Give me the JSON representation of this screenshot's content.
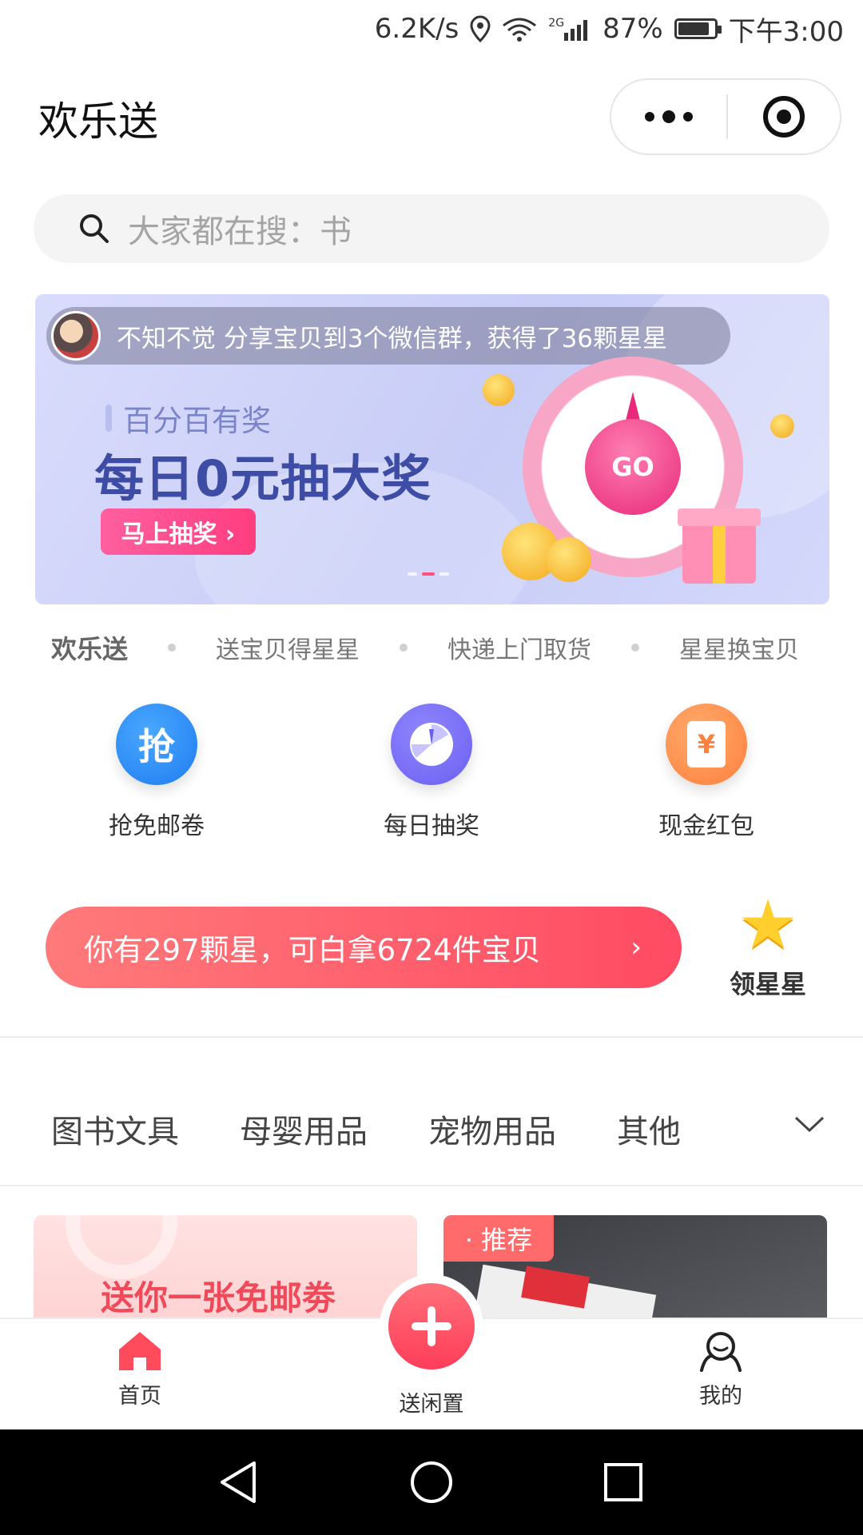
{
  "status_bar": {
    "speed": "6.2K/s",
    "network": "2G",
    "battery_percent": "87%",
    "battery_level": 0.87,
    "time": "下午3:00"
  },
  "header": {
    "title": "欢乐送"
  },
  "search": {
    "placeholder": "大家都在搜：书"
  },
  "banner": {
    "notice": "不知不觉 分享宝贝到3个微信群，获得了36颗星星",
    "subtitle": "百分百有奖",
    "title": "每日0元抽大奖",
    "button": "马上抽奖 ›",
    "wheel_label": "GO"
  },
  "features": {
    "brand": "欢乐送",
    "items": [
      "送宝贝得星星",
      "快递上门取货",
      "星星换宝贝"
    ]
  },
  "shortcuts": [
    {
      "label": "抢免邮卷",
      "glyph": "抢",
      "icon": "grab-icon"
    },
    {
      "label": "每日抽奖",
      "glyph": "",
      "icon": "lottery-wheel-icon"
    },
    {
      "label": "现金红包",
      "glyph": "¥",
      "icon": "red-envelope-icon"
    }
  ],
  "stars_banner": {
    "text": "你有297颗星，可白拿6724件宝贝",
    "arrow": "›",
    "get_label": "领星星"
  },
  "categories": [
    "图书文具",
    "母婴用品",
    "宠物用品",
    "其他"
  ],
  "cards": {
    "left_text": "送你一张免邮劵",
    "right_tag": "· 推荐"
  },
  "tabbar": {
    "home": "首页",
    "post": "送闲置",
    "me": "我的"
  },
  "colors": {
    "accent": "#ff4b63",
    "banner_title": "#3d4ca4",
    "home_tab": "#ff4b5c"
  }
}
